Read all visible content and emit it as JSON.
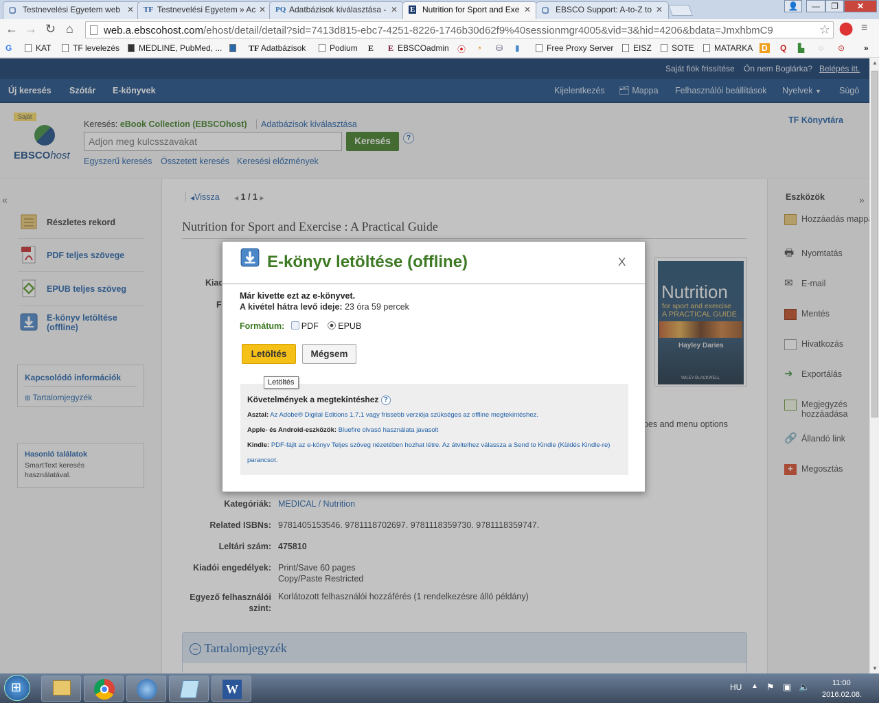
{
  "browser": {
    "tabs": [
      {
        "favicon": "",
        "title": "Testnevelési Egyetem web"
      },
      {
        "favicon": "TF",
        "title": "Testnevelési Egyetem » Ac"
      },
      {
        "favicon": "PQ",
        "title": "Adatbázisok kiválasztása -"
      },
      {
        "favicon": "E",
        "title": "Nutrition for Sport and Exe"
      },
      {
        "favicon": "",
        "title": "EBSCO Support: A-to-Z to"
      }
    ],
    "url_host": "web.a.ebscohost.com",
    "url_path": "/ehost/detail/detail?sid=7413d815-ebc7-4251-8226-1746b30d62f9%40sessionmgr4005&vid=3&hid=4206&bdata=JmxhbmC9",
    "bookmarks": [
      "KAT",
      "TF levelezés",
      "MEDLINE, PubMed, ...",
      "TF",
      "Adatbázisok",
      "Podium",
      "EBSCOadmin",
      "Free Proxy Server",
      "EISZ",
      "SOTE",
      "MATARKA"
    ]
  },
  "topbar": {
    "refresh_account": "Saját fiók frissítése",
    "user_question": "Ön nem Boglárka?",
    "login": "Belépés itt."
  },
  "nav": {
    "left": [
      "Új keresés",
      "Szótár",
      "E-könyvek"
    ],
    "logout": "Kijelentkezés",
    "folder": "Mappa",
    "user_settings": "Felhasználói beállítások",
    "languages": "Nyelvek",
    "help": "Súgó"
  },
  "search": {
    "logo_badge": "Saját",
    "logo_text": "EBSCO",
    "logo_text_italic": "host",
    "searching_label": "Keresés:",
    "database": "eBook Collection (EBSCOhost)",
    "choose_db": "Adatbázisok kiválasztása",
    "placeholder": "Adjon meg kulcsszavakat",
    "button": "Keresés",
    "help": "?",
    "links": [
      "Egyszerű keresés",
      "Összetett keresés",
      "Keresési előzmények"
    ],
    "library": "TF Könyvtára"
  },
  "results": {
    "back": "Vissza",
    "pager": "1 / 1",
    "title": "Nutrition for Sport and Exercise : A Practical Guide"
  },
  "left_panel": {
    "items": [
      "Részletes rekord",
      "PDF teljes szövege",
      "EPUB teljes szöveg",
      "E-könyv letöltése (offline)"
    ],
    "related_heading": "Kapcsolódó információk",
    "toc_link": "Tartalomjegyzék",
    "similar_heading": "Hasonló találatok",
    "similar_text": "SmartText keresés használatával."
  },
  "tools": {
    "heading": "Eszközök",
    "items": [
      "Hozzáadás mappához",
      "Nyomtatás",
      "E-mail",
      "Mentés",
      "Hivatkozás",
      "Exportálás",
      "Megjegyzés hozzáadása",
      "Állandó link",
      "Megosztás"
    ]
  },
  "record": {
    "partial_label_1": "Kiad",
    "partial_label_2": "F",
    "partial_text": "pes and menu options",
    "fields": [
      {
        "label": "Kategóriák:",
        "value": "MEDICAL / Nutrition"
      },
      {
        "label": "Related ISBNs:",
        "value": "9781405153546. 9781118702697. 9781118359730. 9781118359747."
      },
      {
        "label": "Leltári szám:",
        "value": "475810"
      },
      {
        "label": "Kiadói engedélyek:",
        "value": "Print/Save 60 pages",
        "value2": "Copy/Paste Restricted"
      },
      {
        "label": "Egyező felhasználói szint:",
        "value": "Korlátozott felhasználói hozzáférés (1 rendelkezésre álló példány)"
      }
    ],
    "toc_section": "Tartalomjegyzék"
  },
  "cover": {
    "title_line1": "Nutrition",
    "title_line2": "for sport and exercise",
    "title_line3": "A PRACTICAL GUIDE",
    "author": "Hayley Daries",
    "publisher": "WILEY-BLACKWELL"
  },
  "modal": {
    "title": "E-könyv letöltése (offline)",
    "close": "X",
    "checked_out": "Már kivette ezt az e-könyvet.",
    "remaining_label": "A kivétel hátra levő ideje:",
    "remaining_value": "23 óra 59 percek",
    "format_label": "Formátum:",
    "format_pdf": "PDF",
    "format_epub": "EPUB",
    "selected_format": "EPUB",
    "download_button": "Letöltés",
    "cancel_button": "Mégsem",
    "tooltip": "Letöltés",
    "requirements_heading": "Követelmények a megtekintéshez",
    "requirements": [
      {
        "label": "Asztal:",
        "text": "Az Adobe® Digital Editions 1.7.1 vagy frissebb verziója szükséges az offline megtekintéshez."
      },
      {
        "label": "Apple- és Android-eszközök:",
        "text": "Bluefire olvasó használata javasolt"
      },
      {
        "label": "Kindle:",
        "text": "PDF-fájlt az e-könyv Teljes szöveg nézetében hozhat létre. Az átvitelhez válassza a Send to Kindle (Küldés Kindle-re) parancsot."
      }
    ]
  },
  "taskbar": {
    "language": "HU",
    "time": "11:00",
    "date": "2016.02.08."
  },
  "colors": {
    "nav_dark": "#10386b",
    "nav": "#1a4b84",
    "green": "#3d7a23",
    "link": "#1f5fa6",
    "yellow_button": "#f5c118"
  }
}
